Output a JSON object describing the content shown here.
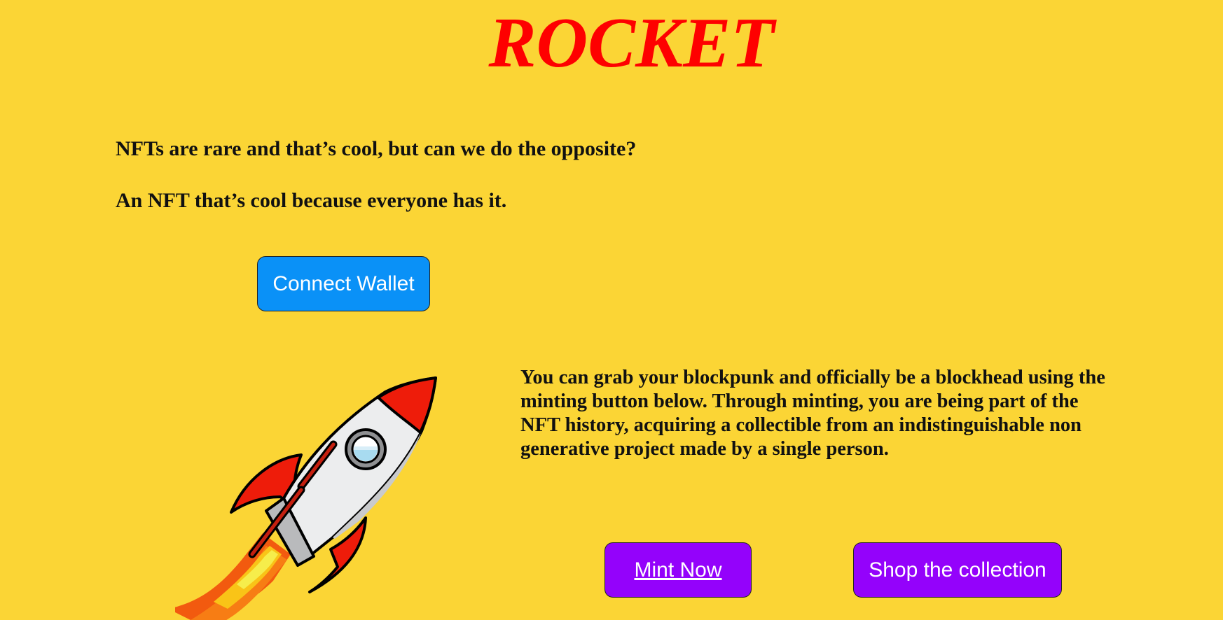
{
  "header": {
    "title": "ROCKET"
  },
  "intro": {
    "line1": "NFTs are rare and that’s cool, but can we do the opposite?",
    "line2": "An NFT that’s cool because everyone has it."
  },
  "wallet": {
    "connect_label": "Connect Wallet"
  },
  "description": {
    "text": "You can grab your blockpunk and officially be a blockhead using the minting button below. Through minting, you are being part of the NFT history, acquiring a collectible from an indistinguishable non generative project made by a single person."
  },
  "actions": {
    "mint_label": "Mint Now",
    "shop_label": "Shop the collection"
  },
  "theme": {
    "background": "#fbd535",
    "title_color": "#fe0000",
    "connect_button": "#0a91f7",
    "action_buttons": "#9402fb"
  },
  "illustration": {
    "icon": "rocket-icon"
  }
}
